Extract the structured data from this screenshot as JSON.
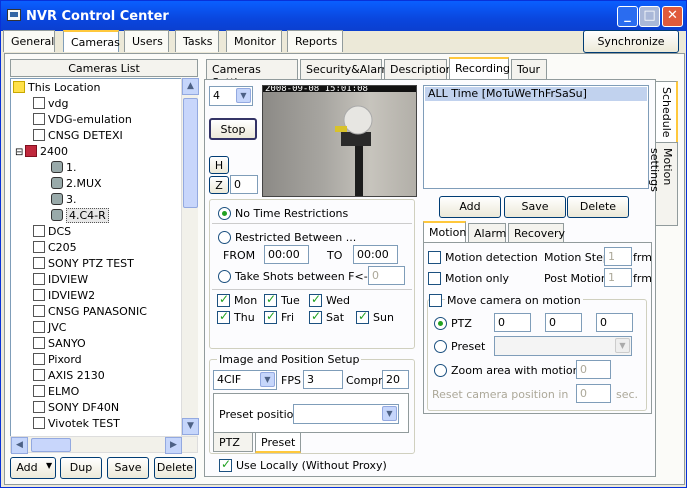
{
  "title": "NVR Control Center",
  "window_buttons": {
    "minimize": "_",
    "maximize": "□",
    "close": "✕"
  },
  "menu_tabs": [
    "General",
    "Cameras",
    "Users",
    "Tasks",
    "Monitor",
    "Reports"
  ],
  "sync_label": "Synchronize",
  "cameras_list": {
    "header": "Cameras List",
    "items": [
      "This Location",
      "vdg",
      "VDG-emulation",
      "CNSG DETEXI",
      "2400",
      "1.",
      "2.MUX",
      "3.",
      "4.C4-R",
      "DCS",
      "C205",
      "SONY PTZ TEST",
      "IDVIEW",
      "IDVIEW2",
      "CNSG PANASONIC",
      "JVC",
      "SANYO",
      "Pixord",
      "AXIS 2130",
      "ELMO",
      "SONY DF40N",
      "Vivotek TEST"
    ],
    "expander": "⊟"
  },
  "left_buttons": {
    "add": "Add",
    "dup": "Dup",
    "save": "Save",
    "delete": "Delete"
  },
  "right_tabs": [
    "Cameras Settings",
    "Security&Alarm",
    "Description",
    "Recording",
    "Tour"
  ],
  "vertical_tabs": [
    "Schedule",
    "Motion settings"
  ],
  "preview": {
    "channel": "4",
    "stop": "Stop",
    "h": "H",
    "z": "Z",
    "z_value": "0",
    "timestamp": "2008-09-08 15:01:08"
  },
  "time": {
    "no_restriction": "No Time Restrictions",
    "restricted": "Restricted Between ...",
    "from": "FROM",
    "from_val": "00:00",
    "to": "TO",
    "to_val": "00:00",
    "shots": "Take Shots between F<->T",
    "shots_val": "0"
  },
  "days": [
    "Mon",
    "Tue",
    "Wed",
    "Thu",
    "Fri",
    "Sat",
    "Sun"
  ],
  "image_setup": {
    "title": "Image and Position Setup",
    "resolution": "4CIF",
    "fps_label": "FPS",
    "fps": "3",
    "compr_label": "Compr.",
    "compr": "20",
    "preset_label": "Preset position:",
    "tab_ptz": "PTZ",
    "tab_preset": "Preset"
  },
  "use_locally": "Use Locally (Without Proxy)",
  "schedule": {
    "entry": "ALL Time [MoTuWeThFrSaSu]",
    "add": "Add",
    "save": "Save",
    "delete": "Delete"
  },
  "motion_tabs": [
    "Motion",
    "Alarm",
    "Recovery"
  ],
  "motion": {
    "detection": "Motion detection",
    "only": "Motion only",
    "step_label": "Motion Step",
    "step_val": "1",
    "post_label": "Post Motion",
    "post_val": "1",
    "frm": "frm",
    "move_camera": "Move camera on motion",
    "ptz": "PTZ",
    "ptz_vals": [
      "0",
      "0",
      "0"
    ],
    "preset": "Preset",
    "zoom_area": "Zoom area with motion",
    "zoom_val": "0",
    "reset": "Reset camera position in",
    "reset_val": "0",
    "sec": "sec."
  }
}
